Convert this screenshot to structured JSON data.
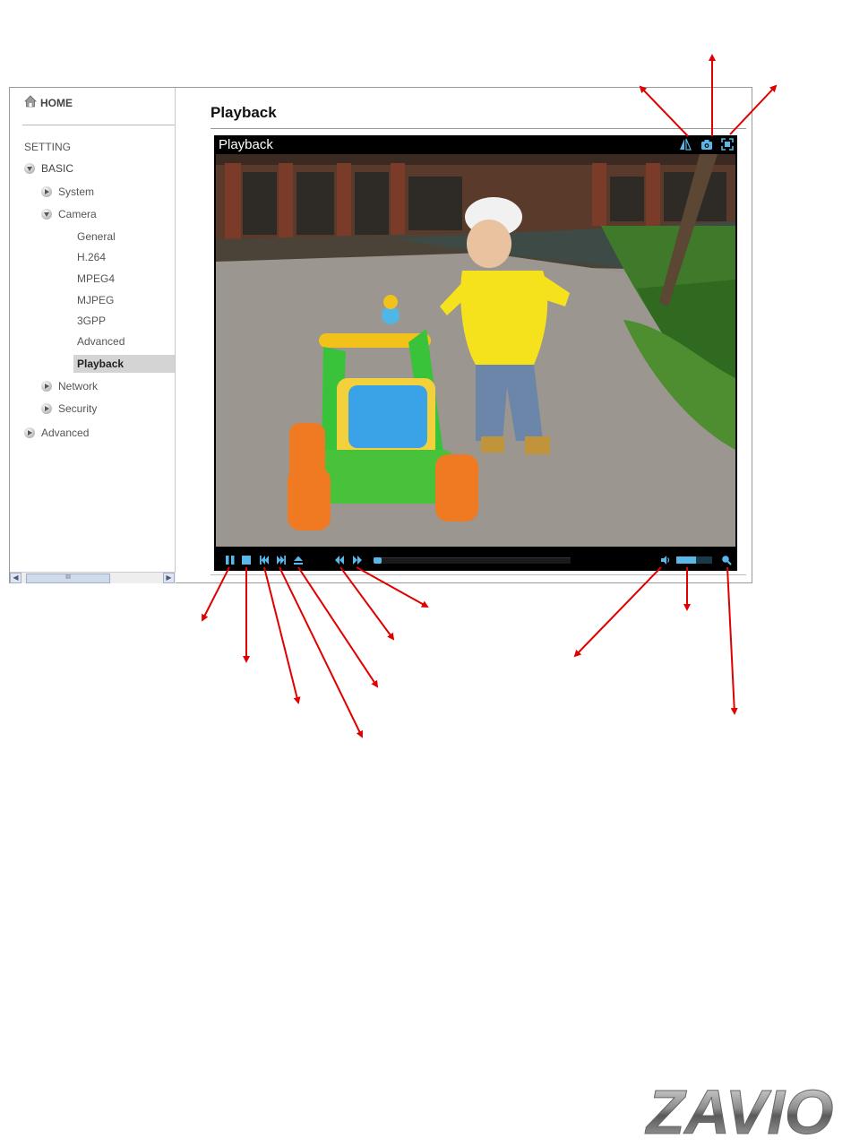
{
  "sidebar": {
    "home": "HOME",
    "setting": "SETTING",
    "basic": "BASIC",
    "system": "System",
    "camera": "Camera",
    "camera_items": [
      "General",
      "H.264",
      "MPEG4",
      "MJPEG",
      "3GPP",
      "Advanced",
      "Playback"
    ],
    "network": "Network",
    "security": "Security",
    "advanced": "Advanced",
    "scroll_thumb": "III"
  },
  "main": {
    "title": "Playback"
  },
  "player": {
    "title": "Playback",
    "top_icons": [
      "flip-icon",
      "snapshot-camera-icon",
      "fullscreen-icon"
    ],
    "controls": [
      "pause-icon",
      "stop-icon",
      "previous-icon",
      "next-icon",
      "eject-icon",
      "rewind-icon",
      "fast-forward-icon",
      "volume-icon",
      "zoom-icon"
    ],
    "progress": 0.0,
    "volume": 0.55
  },
  "colors": {
    "accent_blue": "#5bb7e8",
    "annotation_red": "#e00000",
    "active_item_bg": "#d4d4d4"
  },
  "logo_text": "ZAVIO"
}
